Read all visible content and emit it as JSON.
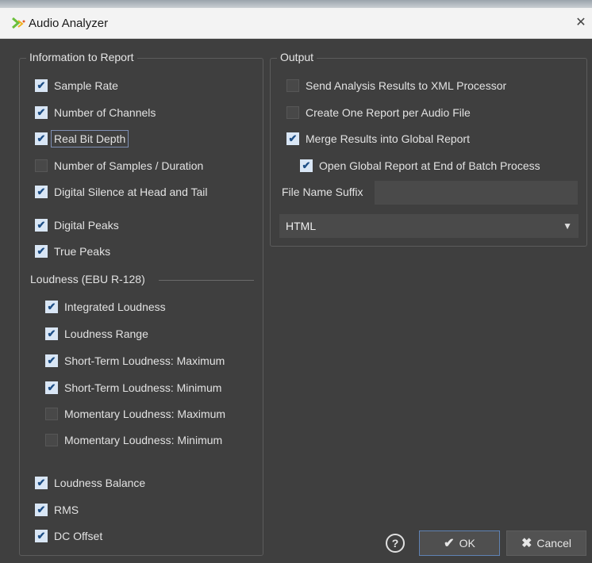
{
  "window": {
    "title": "Audio Analyzer"
  },
  "info_group": {
    "legend": "Information to Report",
    "items": [
      {
        "label": "Sample Rate",
        "checked": true
      },
      {
        "label": "Number of Channels",
        "checked": true
      },
      {
        "label": "Real Bit Depth",
        "checked": true
      },
      {
        "label": "Number of Samples / Duration",
        "checked": false
      },
      {
        "label": "Digital Silence at Head and Tail",
        "checked": true
      },
      {
        "label": "Digital Peaks",
        "checked": true
      },
      {
        "label": "True Peaks",
        "checked": true
      }
    ],
    "loudness_heading": "Loudness (EBU R-128)",
    "loudness_items": [
      {
        "label": "Integrated Loudness",
        "checked": true
      },
      {
        "label": "Loudness Range",
        "checked": true
      },
      {
        "label": "Short-Term Loudness: Maximum",
        "checked": true
      },
      {
        "label": "Short-Term Loudness: Minimum",
        "checked": true
      },
      {
        "label": "Momentary Loudness: Maximum",
        "checked": false
      },
      {
        "label": "Momentary Loudness: Minimum",
        "checked": false
      }
    ],
    "extra_items": [
      {
        "label": "Loudness Balance",
        "checked": true
      },
      {
        "label": "RMS",
        "checked": true
      },
      {
        "label": "DC Offset",
        "checked": true
      }
    ]
  },
  "output_group": {
    "legend": "Output",
    "items": [
      {
        "label": "Send Analysis Results to XML Processor",
        "checked": false
      },
      {
        "label": "Create One Report per Audio File",
        "checked": false
      },
      {
        "label": "Merge Results into Global Report",
        "checked": true
      },
      {
        "label": "Open Global Report at End of Batch Process",
        "checked": true
      }
    ],
    "suffix_label": "File Name Suffix",
    "suffix_value": "",
    "format_value": "HTML"
  },
  "buttons": {
    "help": "?",
    "ok": "OK",
    "cancel": "Cancel"
  },
  "icons": {
    "check": "✔",
    "cancel": "✖",
    "close": "✕",
    "dropdown": "▼"
  }
}
